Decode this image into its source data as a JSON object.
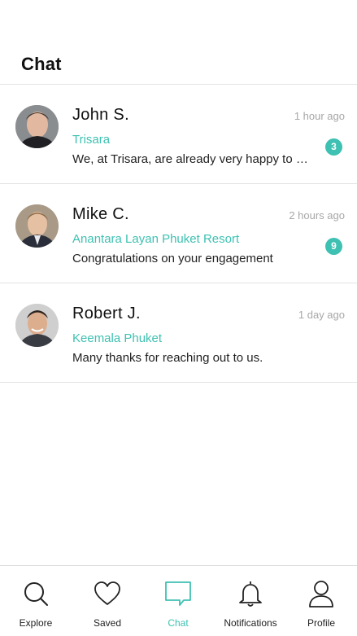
{
  "page": {
    "title": "Chat"
  },
  "chats": [
    {
      "name": "John S.",
      "time": "1 hour ago",
      "hotel": "Trisara",
      "preview": "We, at Trisara, are already very happy to have you",
      "unread": "3"
    },
    {
      "name": "Mike C.",
      "time": "2 hours ago",
      "hotel": "Anantara Layan Phuket Resort",
      "preview": "Congratulations on your engagement",
      "unread": "9"
    },
    {
      "name": "Robert J.",
      "time": "1 day ago",
      "hotel": "Keemala Phuket",
      "preview": "Many thanks for reaching out to us.",
      "unread": ""
    }
  ],
  "tabs": [
    {
      "label": "Explore",
      "icon": "search-icon"
    },
    {
      "label": "Saved",
      "icon": "heart-icon"
    },
    {
      "label": "Chat",
      "icon": "chat-bubble-icon",
      "active": true
    },
    {
      "label": "Notifications",
      "icon": "bell-icon"
    },
    {
      "label": "Profile",
      "icon": "user-icon"
    }
  ],
  "colors": {
    "accent": "#3ec1b2",
    "muted": "#a7a7a7",
    "text": "#111111"
  }
}
